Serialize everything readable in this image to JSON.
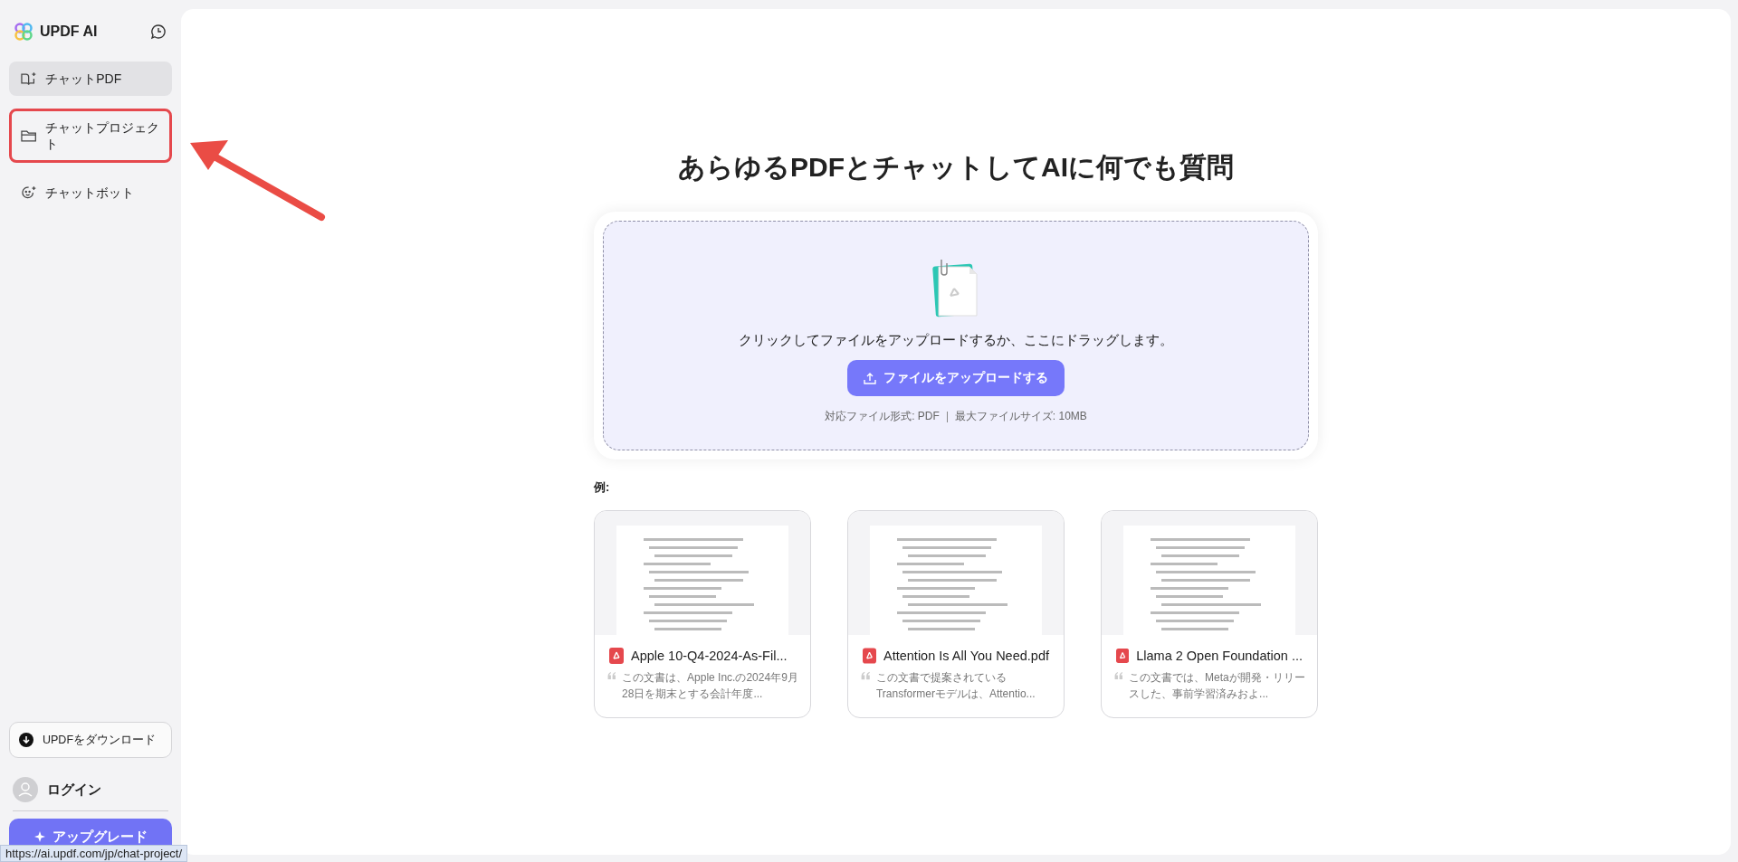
{
  "sidebar": {
    "brand": "UPDF AI",
    "items": [
      {
        "kind": "book",
        "label": "チャットPDF",
        "selected": true,
        "highlighted": false
      },
      {
        "kind": "folder",
        "label": "チャットプロジェクト",
        "selected": false,
        "highlighted": true
      },
      {
        "kind": "bot",
        "label": "チャットボット",
        "selected": false,
        "highlighted": false
      }
    ],
    "download_button": "UPDFをダウンロード",
    "login": "ログイン",
    "upgrade_button": "アップグレード"
  },
  "main": {
    "heading": "あらゆるPDFとチャットしてAIに何でも質問",
    "upload": {
      "prompt": "クリックしてファイルをアップロードするか、ここにドラッグします。",
      "button": "ファイルをアップロードする",
      "formats": "対応ファイル形式: PDF",
      "max_size": "最大ファイルサイズ: 10MB"
    },
    "examples_label": "例:",
    "examples": [
      {
        "title": "Apple 10-Q4-2024-As-Fil...",
        "summary": "この文書は、Apple Inc.の2024年9月28日を期末とする会計年度..."
      },
      {
        "title": "Attention Is All You Need.pdf",
        "summary": "この文書で提案されているTransformerモデルは、Attentio..."
      },
      {
        "title": "Llama 2 Open Foundation ...",
        "summary": "この文書では、Metaが開発・リリースした、事前学習済みおよ..."
      }
    ]
  },
  "status_url": "https://ai.updf.com/jp/chat-project/"
}
